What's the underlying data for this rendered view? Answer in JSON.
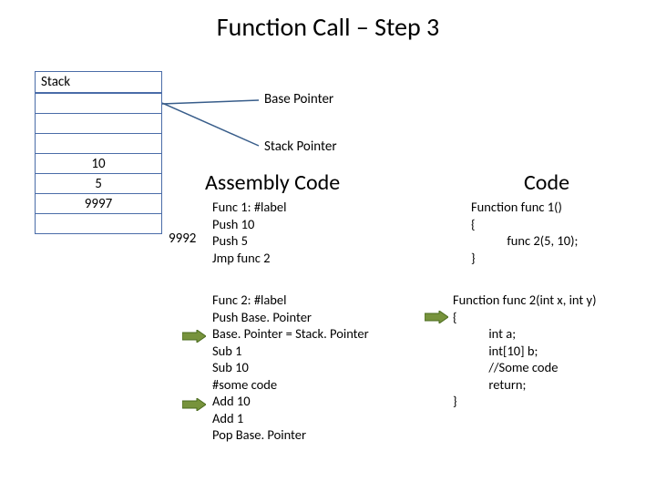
{
  "title": "Function Call – Step 3",
  "stack": {
    "label": "Stack",
    "rows": [
      "",
      "",
      "",
      "10",
      "5",
      "9997",
      ""
    ],
    "side_label": "9992"
  },
  "pointers": {
    "base": "Base Pointer",
    "stack": "Stack Pointer"
  },
  "headings": {
    "asm": "Assembly Code",
    "code": "Code"
  },
  "asm": {
    "block1": "Func 1: #label\nPush 10\nPush 5\nJmp func 2",
    "block2": "Func 2: #label\nPush Base. Pointer\nBase. Pointer = Stack. Pointer\nSub 1\nSub 10\n#some code\nAdd 10\nAdd 1\nPop Base. Pointer"
  },
  "code": {
    "block1": "Function func 1()\n{\n            func 2(5, 10);\n}",
    "block2": "Function func 2(int x, int y)\n{\n            int a;\n            int[10] b;\n            //Some code\n            return;\n}"
  }
}
